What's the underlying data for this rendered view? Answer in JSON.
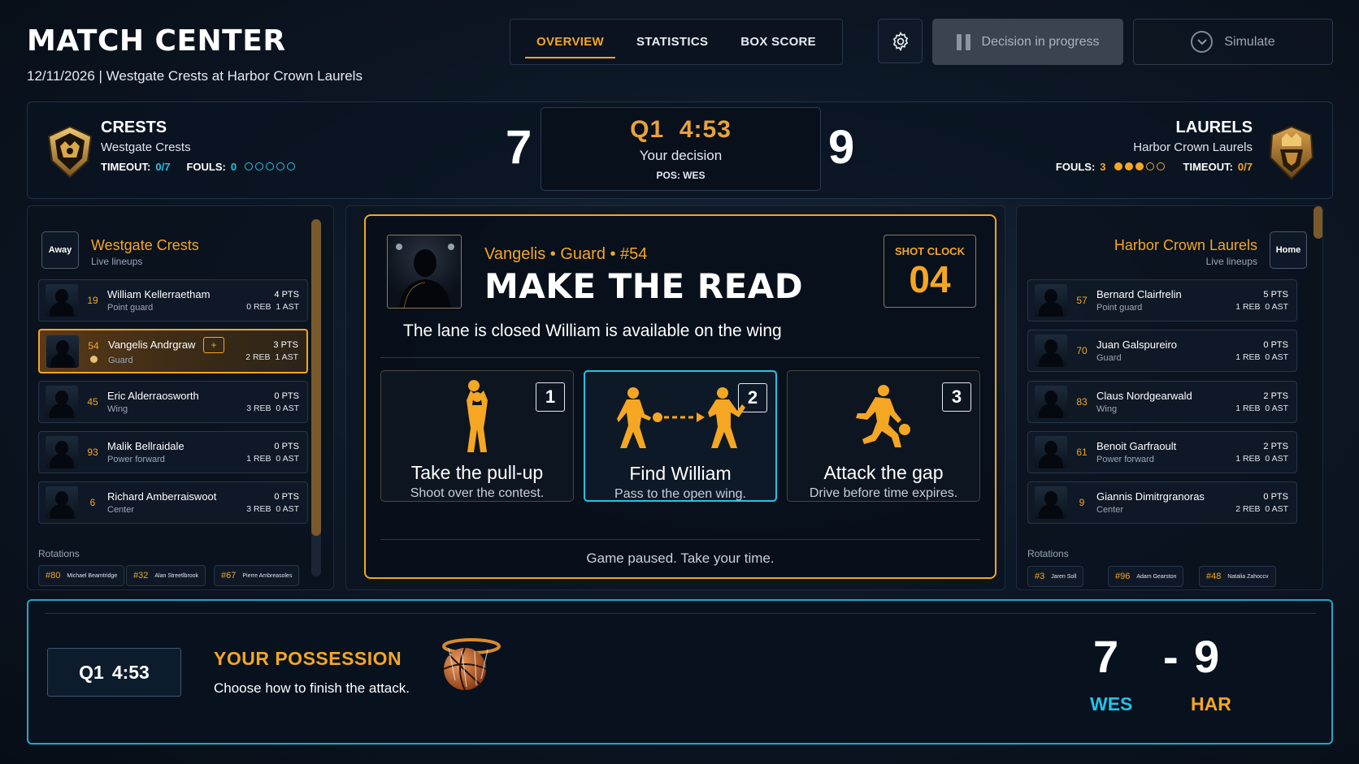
{
  "header": {
    "title": "MATCH CENTER",
    "subtitle": "12/11/2026 | Westgate Crests at Harbor Crown Laurels",
    "tabs": [
      "OVERVIEW",
      "STATISTICS",
      "BOX SCORE"
    ],
    "active_tab": "OVERVIEW",
    "decision_label": "Decision in progress",
    "simulate_label": "Simulate",
    "settings_icon": "gear-icon"
  },
  "scoreboard": {
    "away": {
      "abbr": "CRESTS",
      "name": "Westgate Crests",
      "timeout_label": "TIMEOUT:",
      "timeout": "0/7",
      "fouls_label": "FOULS:",
      "fouls": "0",
      "fouls_count": 0,
      "score": "7"
    },
    "home": {
      "abbr": "LAURELS",
      "name": "Harbor Crown Laurels",
      "timeout_label": "TIMEOUT:",
      "timeout": "0/7",
      "fouls_label": "FOULS:",
      "fouls": "3",
      "fouls_count": 3,
      "score": "9"
    },
    "clock": {
      "period": "Q1",
      "time": "4:53",
      "status": "Your decision",
      "possession": "POS: WES"
    }
  },
  "away_panel": {
    "badge": "Away",
    "title": "Westgate Crests",
    "subtitle": "Live lineups",
    "players": [
      {
        "num": "19",
        "name": "William Kellerraetham",
        "pos": "Point guard",
        "pts": "4 PTS",
        "reb": "0 REB",
        "ast": "1 AST"
      },
      {
        "num": "54",
        "name": "Vangelis Andrgraw",
        "pos": "Guard",
        "pts": "3 PTS",
        "reb": "2 REB",
        "ast": "1 AST",
        "selected": true,
        "action": "+"
      },
      {
        "num": "45",
        "name": "Eric Alderraosworth",
        "pos": "Wing",
        "pts": "0 PTS",
        "reb": "3 REB",
        "ast": "0 AST"
      },
      {
        "num": "93",
        "name": "Malik Bellraidale",
        "pos": "Power forward",
        "pts": "0 PTS",
        "reb": "1 REB",
        "ast": "0 AST"
      },
      {
        "num": "6",
        "name": "Richard Amberraiswoot",
        "pos": "Center",
        "pts": "0 PTS",
        "reb": "3 REB",
        "ast": "0 AST"
      }
    ],
    "rotations_label": "Rotations",
    "rotations": [
      {
        "num": "#80",
        "name": "Michael Beamtridge"
      },
      {
        "num": "#32",
        "name": "Alan Streetlbrook"
      },
      {
        "num": "#67",
        "name": "Pierre Ambreasoles"
      }
    ]
  },
  "home_panel": {
    "badge": "Home",
    "title": "Harbor Crown Laurels",
    "subtitle": "Live lineups",
    "players": [
      {
        "num": "57",
        "name": "Bernard Clairfrelin",
        "pos": "Point guard",
        "pts": "5 PTS",
        "reb": "1 REB",
        "ast": "0 AST"
      },
      {
        "num": "70",
        "name": "Juan Galspureiro",
        "pos": "Guard",
        "pts": "0 PTS",
        "reb": "1 REB",
        "ast": "0 AST"
      },
      {
        "num": "83",
        "name": "Claus Nordgearwald",
        "pos": "Wing",
        "pts": "2 PTS",
        "reb": "1 REB",
        "ast": "0 AST"
      },
      {
        "num": "61",
        "name": "Benoit Garfraoult",
        "pos": "Power forward",
        "pts": "2 PTS",
        "reb": "1 REB",
        "ast": "0 AST"
      },
      {
        "num": "9",
        "name": "Giannis Dimitrgranoras",
        "pos": "Center",
        "pts": "0 PTS",
        "reb": "2 REB",
        "ast": "0 AST"
      }
    ],
    "rotations_label": "Rotations",
    "rotations": [
      {
        "num": "#3",
        "name": "Jaren Soll"
      },
      {
        "num": "#96",
        "name": "Adam Gearston"
      },
      {
        "num": "#48",
        "name": "Natalia Zahoccv"
      }
    ]
  },
  "decision": {
    "player_line": "Vangelis • Guard • #54",
    "title": "MAKE THE READ",
    "shot_clock_label": "SHOT CLOCK",
    "shot_clock": "04",
    "situation": "The lane is closed  William is available on the wing",
    "options": [
      {
        "num": "1",
        "title": "Take the pull-up",
        "desc": "Shoot over the contest.",
        "icon": "shooter-icon"
      },
      {
        "num": "2",
        "title": "Find William",
        "desc": "Pass to the open wing.",
        "icon": "pass-icon",
        "highlighted": true
      },
      {
        "num": "3",
        "title": "Attack the gap",
        "desc": "Drive before time expires.",
        "icon": "drive-icon"
      }
    ],
    "footer_note": "Game paused. Take your time."
  },
  "footer": {
    "clock_period": "Q1",
    "clock_time": "4:53",
    "title": "YOUR POSSESSION",
    "desc": "Choose how to finish the attack.",
    "away_score": "7",
    "dash": "-",
    "home_score": "9",
    "away_abbr": "WES",
    "home_abbr": "HAR"
  },
  "colors": {
    "accent": "#f5a623",
    "highlight": "#22c3e6",
    "background": "#0a1420"
  }
}
